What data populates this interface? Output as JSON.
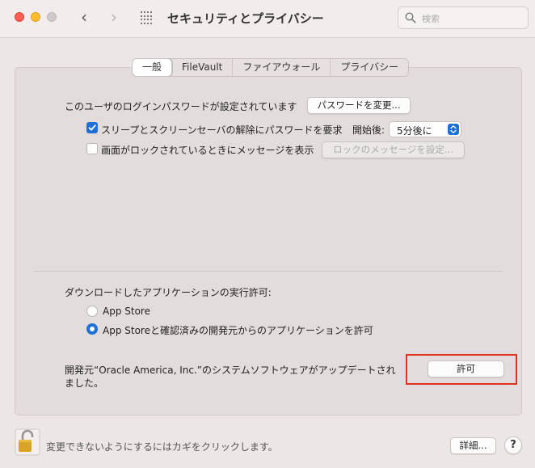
{
  "window": {
    "title": "セキュリティとプライバシー",
    "search_placeholder": "検索"
  },
  "tabs": [
    {
      "label": "一般",
      "active": true
    },
    {
      "label": "FileVault",
      "active": false
    },
    {
      "label": "ファイアウォール",
      "active": false
    },
    {
      "label": "プライバシー",
      "active": false
    }
  ],
  "general": {
    "password_text": "このユーザのログインパスワードが設定されています",
    "change_password_button": "パスワードを変更...",
    "require_password": {
      "label": "スリープとスクリーンセーバの解除にパスワードを要求",
      "checked": true,
      "after_label": "開始後:",
      "selected": "5分後に"
    },
    "lock_message": {
      "label": "画面がロックされているときにメッセージを表示",
      "checked": false,
      "button": "ロックのメッセージを設定..."
    },
    "download_section": {
      "title": "ダウンロードしたアプリケーションの実行許可:",
      "options": [
        {
          "label": "App Store",
          "selected": false
        },
        {
          "label": "App Storeと確認済みの開発元からのアプリケーションを許可",
          "selected": true
        }
      ]
    },
    "blocked_notice": {
      "line1": "開発元“Oracle America, Inc.”のシステムソフトウェアがアップデートされ",
      "line2": "ました。",
      "allow_button": "許可"
    }
  },
  "footer": {
    "lock_text": "変更できないようにするにはカギをクリックします。",
    "advanced_button": "詳細...",
    "help_label": "?"
  },
  "colors": {
    "accent": "#1f6fd9",
    "highlight": "#e0321e"
  }
}
